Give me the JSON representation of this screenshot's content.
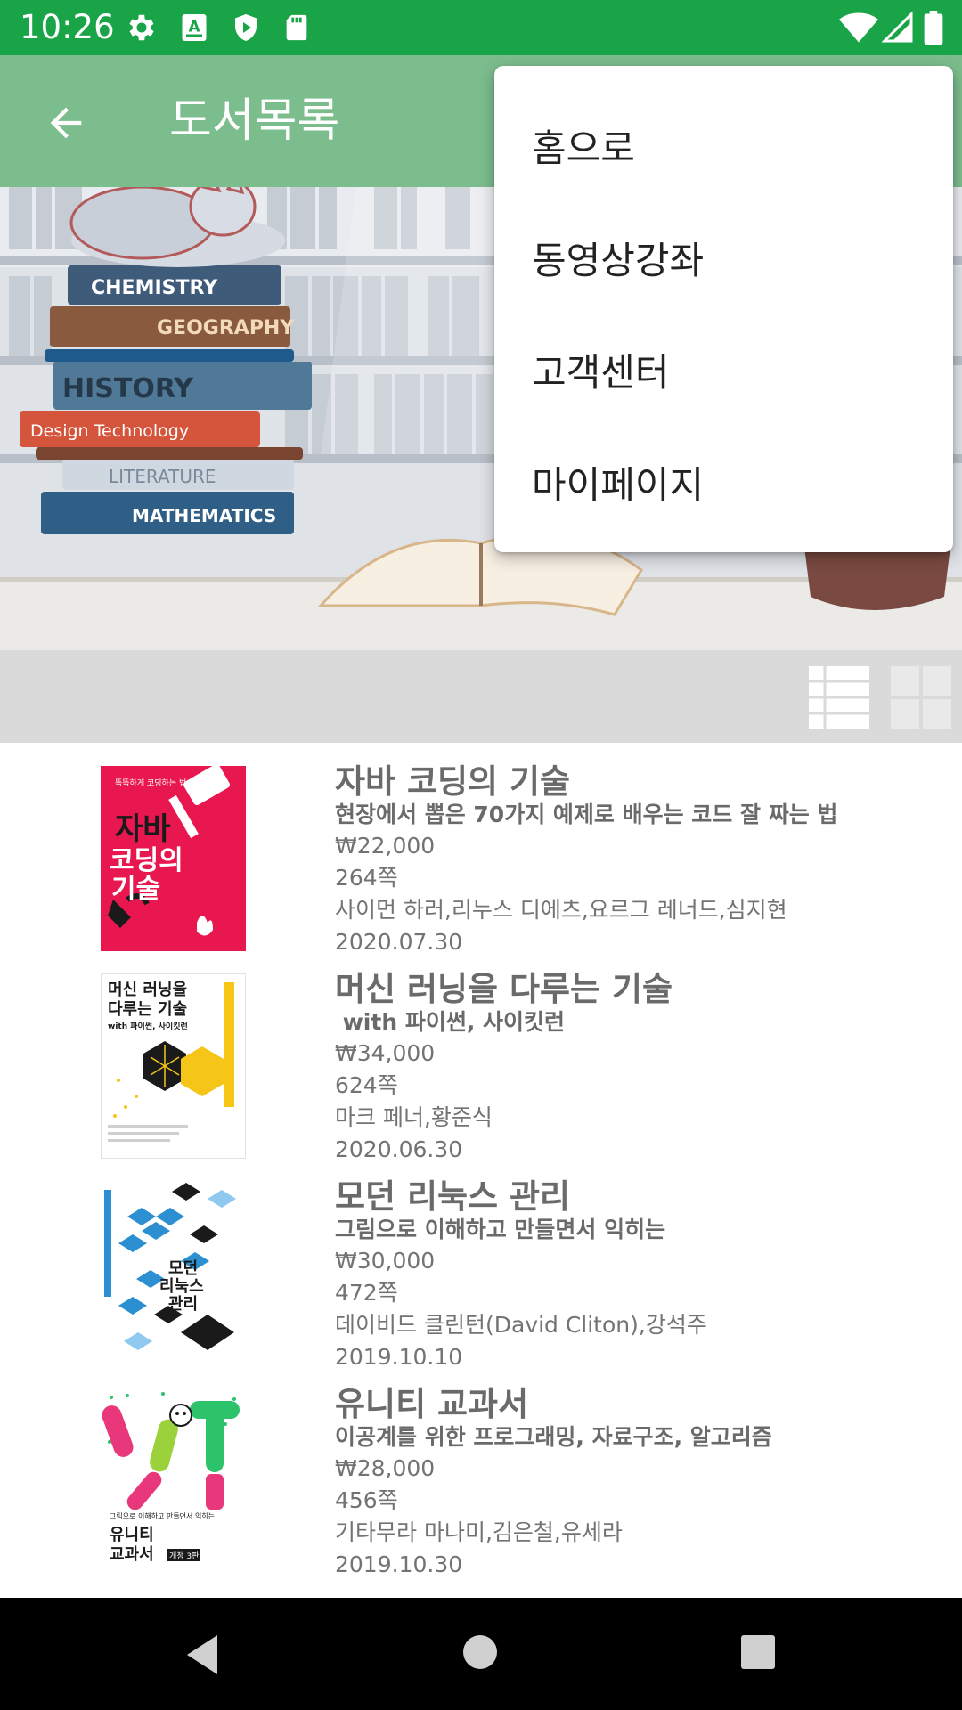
{
  "status_bar": {
    "time": "10:26",
    "left_icons": [
      "gear-icon",
      "a-keyboard-icon",
      "shield-play-icon",
      "sd-card-icon"
    ],
    "right_icons": [
      "wifi-icon",
      "signal-icon",
      "battery-icon"
    ]
  },
  "app_bar": {
    "back_icon": "arrow-back-icon",
    "title": "도서목록"
  },
  "banner": {
    "book_spines": [
      "CHEMISTRY",
      "GEOGRAPHY",
      "HISTORY",
      "Design Technology",
      "LITERATURE",
      "MATHEMATICS"
    ]
  },
  "view_toggle": {
    "list_icon": "list-view-icon",
    "grid_icon": "grid-view-icon"
  },
  "books": [
    {
      "title": "자바 코딩의 기술",
      "subtitle": "현장에서 뽑은 70가지 예제로 배우는 코드 잘 짜는 법",
      "price": "₩22,000",
      "pages": "264쪽",
      "authors": "사이먼 하러,리누스 디에츠,요르그 레너드,심지현",
      "date": "2020.07.30",
      "cover": {
        "top_text": "똑똑하게 코딩하는 법",
        "title_lines": [
          "자바",
          "코딩의",
          "기술"
        ],
        "bg": "#e8174f"
      }
    },
    {
      "title": "머신 러닝을 다루는 기술",
      "subtitle": " with 파이썬, 사이킷런",
      "price": "₩34,000",
      "pages": "624쪽",
      "authors": "마크 페너,황준식",
      "date": "2020.06.30",
      "cover": {
        "title_lines": [
          "머신 러닝을",
          "다루는 기술",
          "with 파이썬, 사이킷런"
        ],
        "bg": "#ffffff"
      }
    },
    {
      "title": "모던 리눅스 관리",
      "subtitle": "그림으로 이해하고 만들면서 익히는",
      "price": "₩30,000",
      "pages": "472쪽",
      "authors": "데이비드 클린턴(David Cliton),강석주",
      "date": "2019.10.10",
      "cover": {
        "title_lines": [
          "모던",
          "리눅스",
          "관리"
        ],
        "bg": "#ffffff"
      }
    },
    {
      "title": "유니티 교과서",
      "subtitle": "이공계를 위한 프로그래밍, 자료구조, 알고리즘",
      "price": "₩28,000",
      "pages": "456쪽",
      "authors": "기타무라 마나미,김은철,유세라",
      "date": "2019.10.30",
      "cover": {
        "top_text": "그림으로 이해하고 만들면서 익히는",
        "title_lines": [
          "유니티",
          "교과서"
        ],
        "edition": "개정 3판",
        "bg": "#ffffff"
      }
    }
  ],
  "overflow_menu": {
    "items": [
      "홈으로",
      "동영상강좌",
      "고객센터",
      "마이페이지"
    ]
  },
  "nav_bar": {
    "icons": [
      "nav-back-icon",
      "nav-home-icon",
      "nav-recents-icon"
    ]
  },
  "colors": {
    "status_bar": "#19a448",
    "app_bar": "#7cbd8d",
    "toggle_bar": "#dadada",
    "nav_bar": "#000000"
  }
}
